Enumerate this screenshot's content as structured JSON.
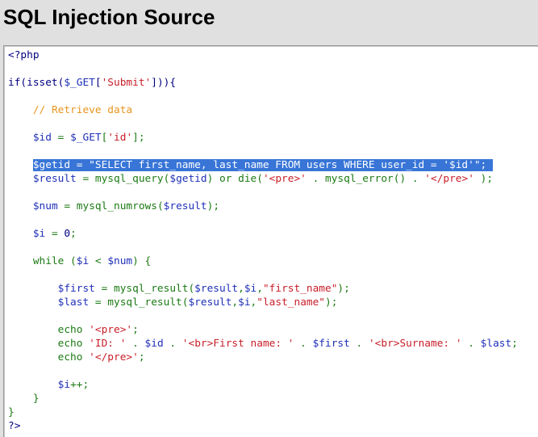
{
  "window": {
    "title": "SQL Injection Source"
  },
  "code": {
    "lines": [
      [
        {
          "t": "<?php",
          "c": "plain"
        }
      ],
      [],
      [
        {
          "t": "if(isset(",
          "c": "plain"
        },
        {
          "t": "$_GET",
          "c": "var"
        },
        {
          "t": "[",
          "c": "plain"
        },
        {
          "t": "'Submit'",
          "c": "str"
        },
        {
          "t": "])){",
          "c": "plain"
        }
      ],
      [],
      [
        {
          "t": "    ",
          "c": "plain"
        },
        {
          "t": "// Retrieve data",
          "c": "comment"
        }
      ],
      [],
      [
        {
          "t": "    ",
          "c": "plain"
        },
        {
          "t": "$id",
          "c": "var"
        },
        {
          "t": " = ",
          "c": "sym"
        },
        {
          "t": "$_GET",
          "c": "var"
        },
        {
          "t": "[",
          "c": "sym"
        },
        {
          "t": "'id'",
          "c": "str"
        },
        {
          "t": "];",
          "c": "sym"
        }
      ],
      [],
      [
        {
          "t": "    ",
          "c": "plain"
        },
        {
          "t": "$getid = \"SELECT first_name, last_name FROM users WHERE user_id = '$id'\"; ",
          "c": "hl"
        }
      ],
      [
        {
          "t": "    ",
          "c": "plain"
        },
        {
          "t": "$result",
          "c": "var"
        },
        {
          "t": " = ",
          "c": "sym"
        },
        {
          "t": "mysql_query",
          "c": "fn"
        },
        {
          "t": "(",
          "c": "sym"
        },
        {
          "t": "$getid",
          "c": "var"
        },
        {
          "t": ") or die(",
          "c": "kw"
        },
        {
          "t": "'<pre>'",
          "c": "str"
        },
        {
          "t": " . ",
          "c": "sym"
        },
        {
          "t": "mysql_error",
          "c": "fn"
        },
        {
          "t": "() . ",
          "c": "sym"
        },
        {
          "t": "'</pre>'",
          "c": "str"
        },
        {
          "t": " );",
          "c": "sym"
        }
      ],
      [],
      [
        {
          "t": "    ",
          "c": "plain"
        },
        {
          "t": "$num",
          "c": "var"
        },
        {
          "t": " = ",
          "c": "sym"
        },
        {
          "t": "mysql_numrows",
          "c": "fn"
        },
        {
          "t": "(",
          "c": "sym"
        },
        {
          "t": "$result",
          "c": "var"
        },
        {
          "t": ");",
          "c": "sym"
        }
      ],
      [],
      [
        {
          "t": "    ",
          "c": "plain"
        },
        {
          "t": "$i",
          "c": "var"
        },
        {
          "t": " = ",
          "c": "sym"
        },
        {
          "t": "0",
          "c": "num"
        },
        {
          "t": ";",
          "c": "sym"
        }
      ],
      [],
      [
        {
          "t": "    ",
          "c": "plain"
        },
        {
          "t": "while (",
          "c": "kw"
        },
        {
          "t": "$i",
          "c": "var"
        },
        {
          "t": " < ",
          "c": "sym"
        },
        {
          "t": "$num",
          "c": "var"
        },
        {
          "t": ") {",
          "c": "sym"
        }
      ],
      [],
      [
        {
          "t": "        ",
          "c": "plain"
        },
        {
          "t": "$first",
          "c": "var"
        },
        {
          "t": " = ",
          "c": "sym"
        },
        {
          "t": "mysql_result",
          "c": "fn"
        },
        {
          "t": "(",
          "c": "sym"
        },
        {
          "t": "$result",
          "c": "var"
        },
        {
          "t": ",",
          "c": "sym"
        },
        {
          "t": "$i",
          "c": "var"
        },
        {
          "t": ",",
          "c": "sym"
        },
        {
          "t": "\"first_name\"",
          "c": "str"
        },
        {
          "t": ");",
          "c": "sym"
        }
      ],
      [
        {
          "t": "        ",
          "c": "plain"
        },
        {
          "t": "$last",
          "c": "var"
        },
        {
          "t": " = ",
          "c": "sym"
        },
        {
          "t": "mysql_result",
          "c": "fn"
        },
        {
          "t": "(",
          "c": "sym"
        },
        {
          "t": "$result",
          "c": "var"
        },
        {
          "t": ",",
          "c": "sym"
        },
        {
          "t": "$i",
          "c": "var"
        },
        {
          "t": ",",
          "c": "sym"
        },
        {
          "t": "\"last_name\"",
          "c": "str"
        },
        {
          "t": ");",
          "c": "sym"
        }
      ],
      [],
      [
        {
          "t": "        ",
          "c": "plain"
        },
        {
          "t": "echo ",
          "c": "kw"
        },
        {
          "t": "'<pre>'",
          "c": "str"
        },
        {
          "t": ";",
          "c": "sym"
        }
      ],
      [
        {
          "t": "        ",
          "c": "plain"
        },
        {
          "t": "echo ",
          "c": "kw"
        },
        {
          "t": "'ID: '",
          "c": "str"
        },
        {
          "t": " . ",
          "c": "sym"
        },
        {
          "t": "$id",
          "c": "var"
        },
        {
          "t": " . ",
          "c": "sym"
        },
        {
          "t": "'<br>First name: '",
          "c": "str"
        },
        {
          "t": " . ",
          "c": "sym"
        },
        {
          "t": "$first",
          "c": "var"
        },
        {
          "t": " . ",
          "c": "sym"
        },
        {
          "t": "'<br>Surname: '",
          "c": "str"
        },
        {
          "t": " . ",
          "c": "sym"
        },
        {
          "t": "$last",
          "c": "var"
        },
        {
          "t": ";",
          "c": "sym"
        }
      ],
      [
        {
          "t": "        ",
          "c": "plain"
        },
        {
          "t": "echo ",
          "c": "kw"
        },
        {
          "t": "'</pre>'",
          "c": "str"
        },
        {
          "t": ";",
          "c": "sym"
        }
      ],
      [],
      [
        {
          "t": "        ",
          "c": "plain"
        },
        {
          "t": "$i",
          "c": "var"
        },
        {
          "t": "++;",
          "c": "sym"
        }
      ],
      [
        {
          "t": "    }",
          "c": "sym"
        }
      ],
      [
        {
          "t": "}",
          "c": "kw"
        }
      ],
      [
        {
          "t": "?>",
          "c": "plain"
        }
      ]
    ]
  }
}
